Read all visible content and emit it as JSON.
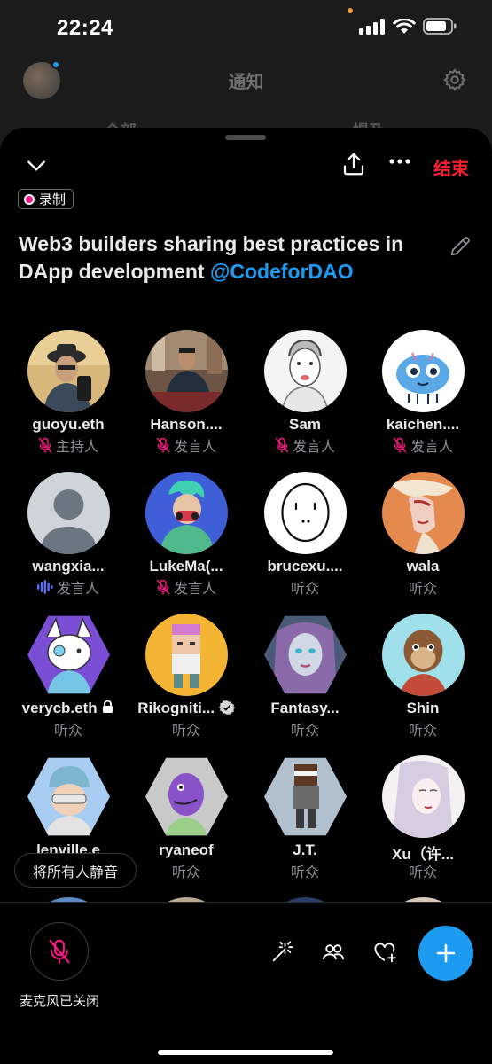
{
  "status_bar": {
    "time": "22:24"
  },
  "background": {
    "title": "通知",
    "tabs": [
      "全部",
      "提及"
    ]
  },
  "space": {
    "recording_label": "录制",
    "end_label": "结束",
    "title": "Web3 builders sharing best practices in DApp development",
    "title_handle": "@CodeforDAO"
  },
  "participants": [
    {
      "name": "guoyu.eth",
      "role": "主持人",
      "mic": "muted"
    },
    {
      "name": "Hanson....",
      "role": "发言人",
      "mic": "muted"
    },
    {
      "name": "Sam",
      "role": "发言人",
      "mic": "muted"
    },
    {
      "name": "kaichen....",
      "role": "发言人",
      "mic": "muted"
    },
    {
      "name": "wangxia...",
      "role": "发言人",
      "mic": "speaking"
    },
    {
      "name": "LukeMa(...",
      "role": "发言人",
      "mic": "muted"
    },
    {
      "name": "brucexu....",
      "role": "听众"
    },
    {
      "name": "wala",
      "role": "听众"
    },
    {
      "name": "verycb.eth",
      "role": "听众",
      "badge": "lock"
    },
    {
      "name": "Rikogniti...",
      "role": "听众",
      "badge": "verified"
    },
    {
      "name": "Fantasy...",
      "role": "听众"
    },
    {
      "name": "Shin",
      "role": "听众"
    },
    {
      "name": "lenville.e",
      "role": "听众"
    },
    {
      "name": "ryaneof",
      "role": "听众"
    },
    {
      "name": "J.T.",
      "role": "听众"
    },
    {
      "name": "Xu（许...",
      "role": "听众"
    }
  ],
  "controls": {
    "mute_all": "将所有人静音",
    "mic_label": "麦克风已关闭"
  },
  "colors": {
    "accent": "#1d9bf0",
    "end_red": "#f4212e",
    "mute_pink": "#f91880",
    "speaking_blue": "#5b6cf5"
  }
}
